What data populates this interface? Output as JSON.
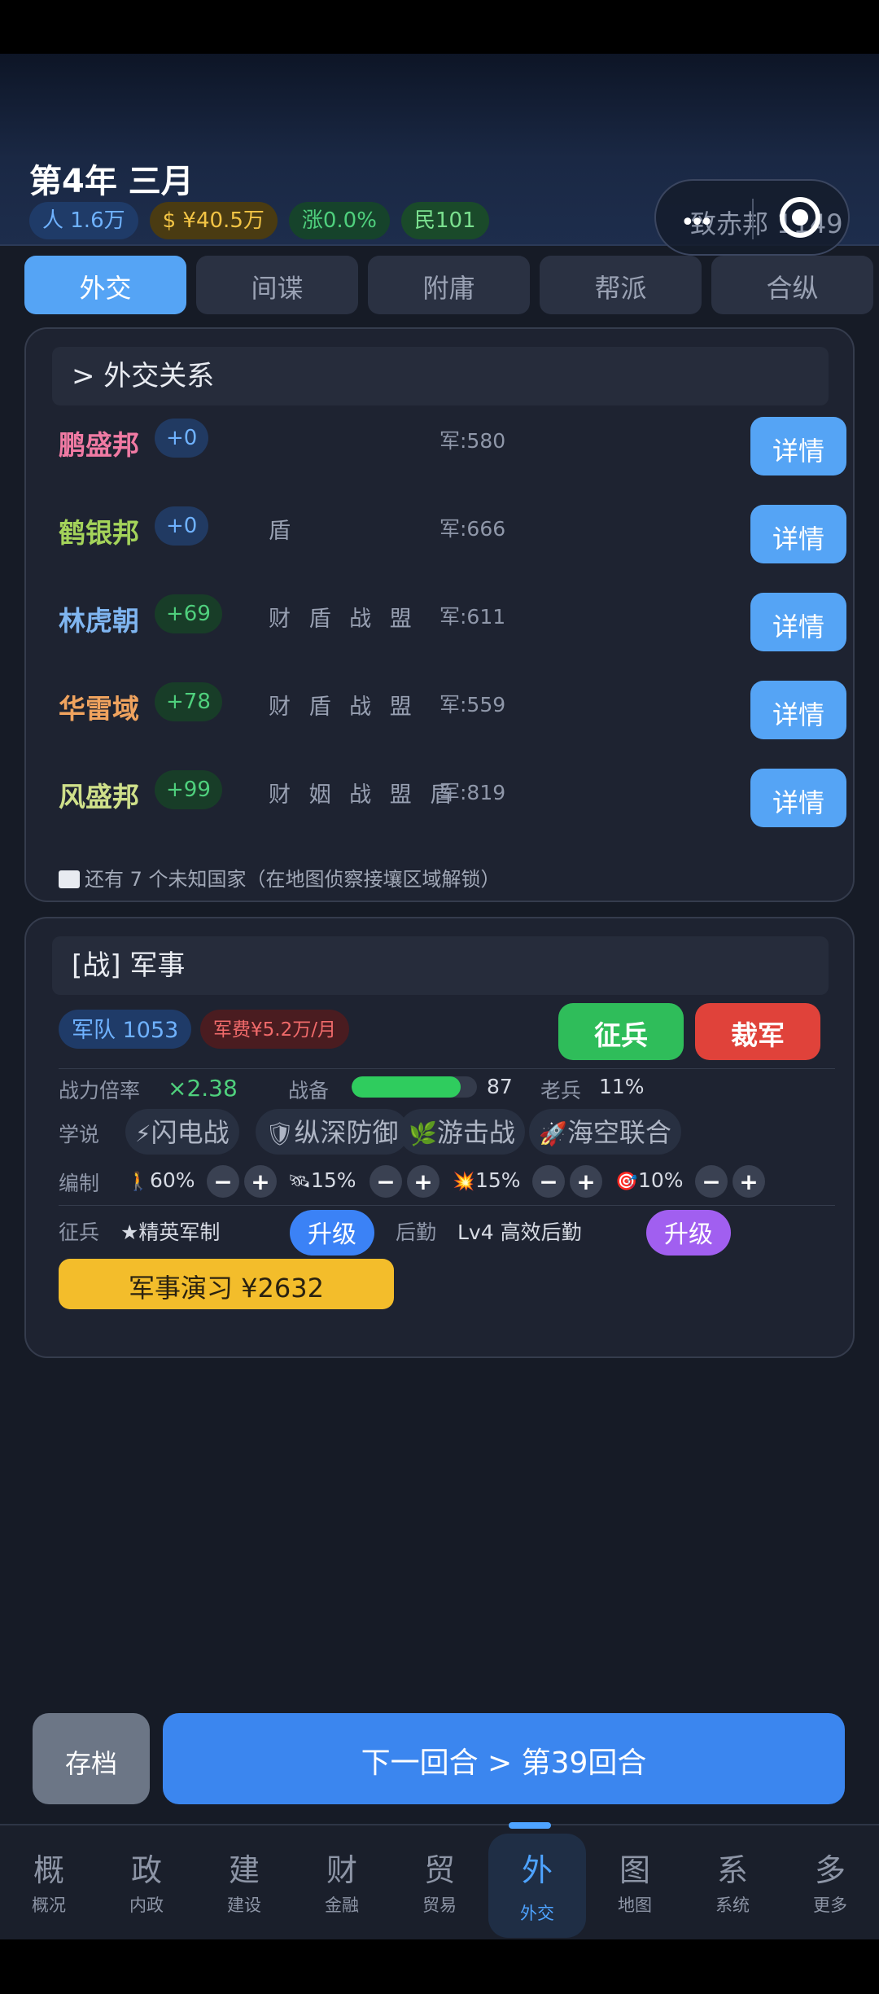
{
  "header": {
    "title": "第4年 三月",
    "stats": {
      "population": "人 1.6万",
      "money": "$ ¥40.5万",
      "inflation": "涨0.0%",
      "people": "民101"
    },
    "capsule_text": "致赤邦 1149"
  },
  "tabs": [
    "外交",
    "间谍",
    "附庸",
    "帮派",
    "合纵"
  ],
  "diplomacy": {
    "title": ">  外交关系",
    "rows": [
      {
        "name": "鹏盛邦",
        "relation": "+0",
        "tags": "",
        "army": "军:580",
        "button": "详情",
        "color": "#f07aa3"
      },
      {
        "name": "鹤银邦",
        "relation": "+0",
        "tags": "盾",
        "army": "军:666",
        "button": "详情",
        "color": "#a4d35a"
      },
      {
        "name": "林虎朝",
        "relation": "+69",
        "tags": "财 盾 战 盟",
        "army": "军:611",
        "button": "详情",
        "color": "#7fb5f0"
      },
      {
        "name": "华雷域",
        "relation": "+78",
        "tags": "财 盾 战 盟",
        "army": "军:559",
        "button": "详情",
        "color": "#f0a35e"
      },
      {
        "name": "风盛邦",
        "relation": "+99",
        "tags": "财 姻 战 盟 盾",
        "army": "军:819",
        "button": "详情",
        "color": "#cfe08a"
      }
    ],
    "unknown": "还有 7 个未知国家（在地图侦察接壤区域解锁）"
  },
  "military": {
    "title": "[战]  军事",
    "army": "军队 1053",
    "cost": "军费¥5.2万/月",
    "recruit": "征兵",
    "disband": "裁军",
    "power_label": "战力倍率",
    "power_value": "×2.38",
    "readiness_label": "战备",
    "readiness_value": 87,
    "readiness_text": "87",
    "veteran_label": "老兵",
    "veteran_value": "11%",
    "doctrine_label": "学说",
    "doctrines": [
      {
        "icon": "⚡",
        "name": "闪电战"
      },
      {
        "icon": "🛡",
        "name": "纵深防御"
      },
      {
        "icon": "🌿",
        "name": "游击战"
      },
      {
        "icon": "🚀",
        "name": "海空联合"
      }
    ],
    "org_label": "编制",
    "org": [
      {
        "icon": "🚶",
        "value": "60%"
      },
      {
        "icon": "🛰",
        "value": "15%"
      },
      {
        "icon": "💥",
        "value": "15%"
      },
      {
        "icon": "🎯",
        "value": "10%"
      }
    ],
    "conscript_label": "征兵",
    "conscript_value": "★精英军制",
    "upgrade": "升级",
    "logistics_label": "后勤",
    "logistics_value": "Lv4 高效后勤",
    "exercise": "军事演习 ¥2632"
  },
  "actions": {
    "save": "存档",
    "next": "下一回合 > 第39回合"
  },
  "nav": [
    {
      "big": "概",
      "small": "概况"
    },
    {
      "big": "政",
      "small": "内政"
    },
    {
      "big": "建",
      "small": "建设"
    },
    {
      "big": "财",
      "small": "金融"
    },
    {
      "big": "贸",
      "small": "贸易"
    },
    {
      "big": "外",
      "small": "外交"
    },
    {
      "big": "图",
      "small": "地图"
    },
    {
      "big": "系",
      "small": "系统"
    },
    {
      "big": "多",
      "small": "更多"
    }
  ]
}
